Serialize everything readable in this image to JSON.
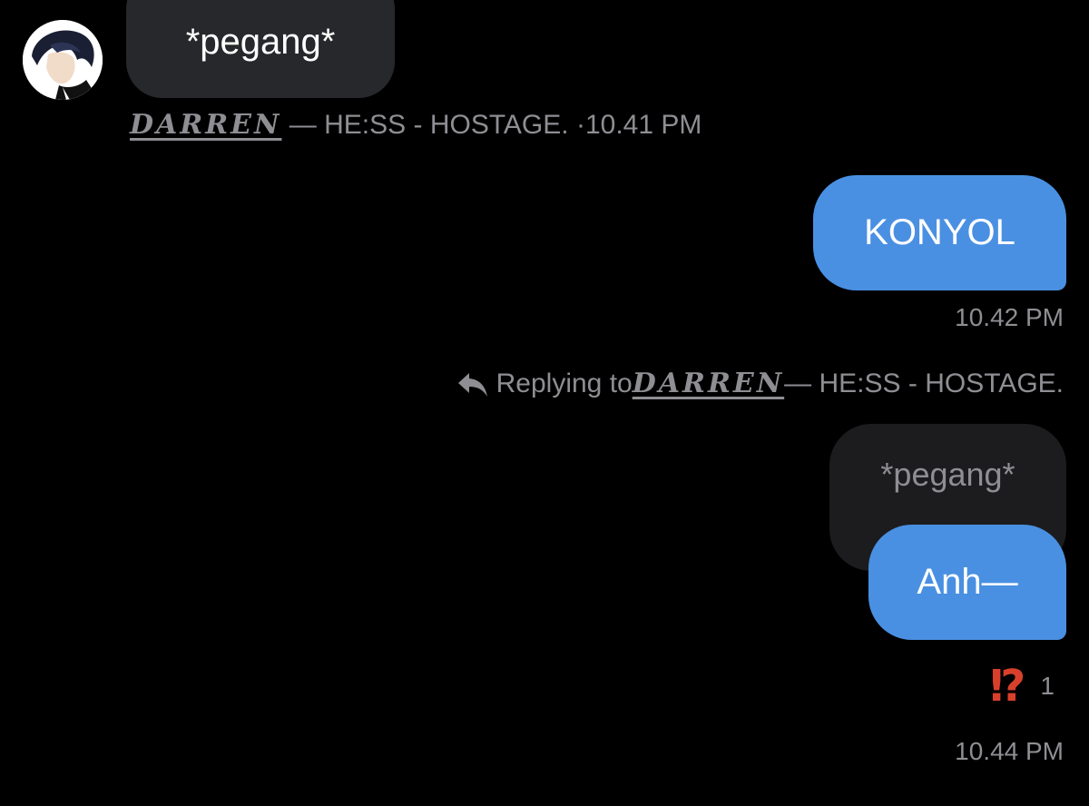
{
  "messages": {
    "incoming": {
      "text": "*pegang*",
      "sender_name": "DARREN",
      "sender_suffix": " — HE:SS - HOSTAGE.",
      "time": " ·10.41 PM"
    },
    "outgoing_1": {
      "text": "KONYOL",
      "time": "10.42 PM"
    },
    "reply": {
      "prefix": "Replying to ",
      "name": "DARREN",
      "suffix": " — HE:SS - HOSTAGE.",
      "quoted_text": "*pegang*",
      "text": "Anh—",
      "reaction_emoji": "⁉",
      "reaction_count": "1",
      "time": "10.44 PM"
    }
  },
  "icons": {
    "reply": "reply-arrow-icon",
    "avatar": "avatar"
  },
  "colors": {
    "background": "#000000",
    "outgoing_bubble": "#4a90e2",
    "incoming_bubble": "#27282b",
    "quoted_bubble": "#1c1c1e",
    "meta_text": "#8e8e93",
    "reaction": "#d9402c"
  }
}
